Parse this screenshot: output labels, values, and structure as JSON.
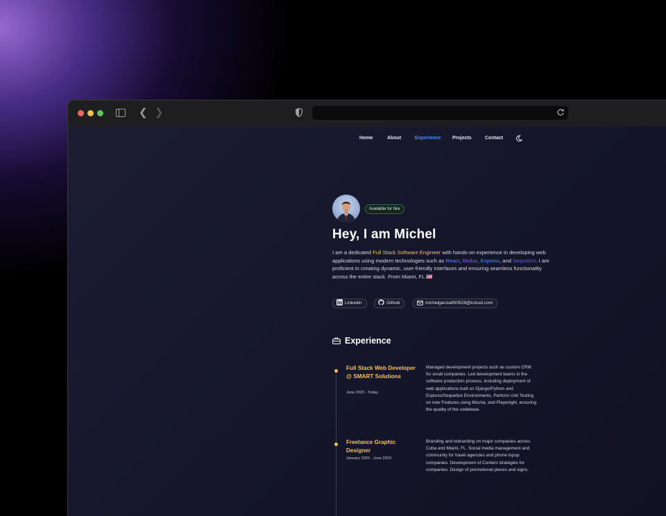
{
  "browser": {
    "url": ""
  },
  "nav": {
    "items": [
      {
        "label": "Home"
      },
      {
        "label": "About"
      },
      {
        "label": "Experience",
        "active": true
      },
      {
        "label": "Projects"
      },
      {
        "label": "Contact"
      }
    ],
    "theme_icon": "moon-icon"
  },
  "hero": {
    "badge": "Available for hire",
    "title": "Hey, I am Michel",
    "intro": {
      "p1": "I am a dedicated ",
      "role": "Full Stack Software Engineer",
      "p2": " with hands-on experience in developing web applications using modern technologies such as ",
      "tech1": "React",
      "sep1": ", ",
      "tech2": "Redux",
      "sep2": ", ",
      "tech3": "Express",
      "sep3": ", and ",
      "tech4": "Sequelize",
      "p3": ". I am proficient in creating dynamic, user-friendly interfaces and ensuring seamless functionality across the entire stack. From Miami, FL 🇺🇸"
    },
    "links": {
      "linkedin": "Linkedin",
      "github": "Github",
      "email": "michelgarcia950528@icloud.com"
    }
  },
  "experience": {
    "heading": "Experience",
    "jobs": [
      {
        "title": "Full Stack Web Developer @ SMART Solutions",
        "dates": "June 2023 - Today",
        "description": "Managed development projects such as custom CRM for small companies. Led development teams in the software production process, including deployment of web applications built on Django/Python and Express/Sequelize Environments. Perform Unit Testing on new Features using Mocha, and Playwright, ensuring the quality of the codebase."
      },
      {
        "title": "Freelance Graphic Designer",
        "dates": "January 2020 - June 2023",
        "description": "Branding and rebranding on major companies across Cuba and Miami, FL. Social media management and community for travel agencies and phone topup companies. Development of Content strategies for companies. Design of promotional pieces and signs."
      }
    ]
  },
  "colors": {
    "accent_yellow": "#f5c15b",
    "accent_blue": "#4c8dff",
    "accent_purple": "#8b5cf6",
    "nav_active": "#4a8cff"
  }
}
